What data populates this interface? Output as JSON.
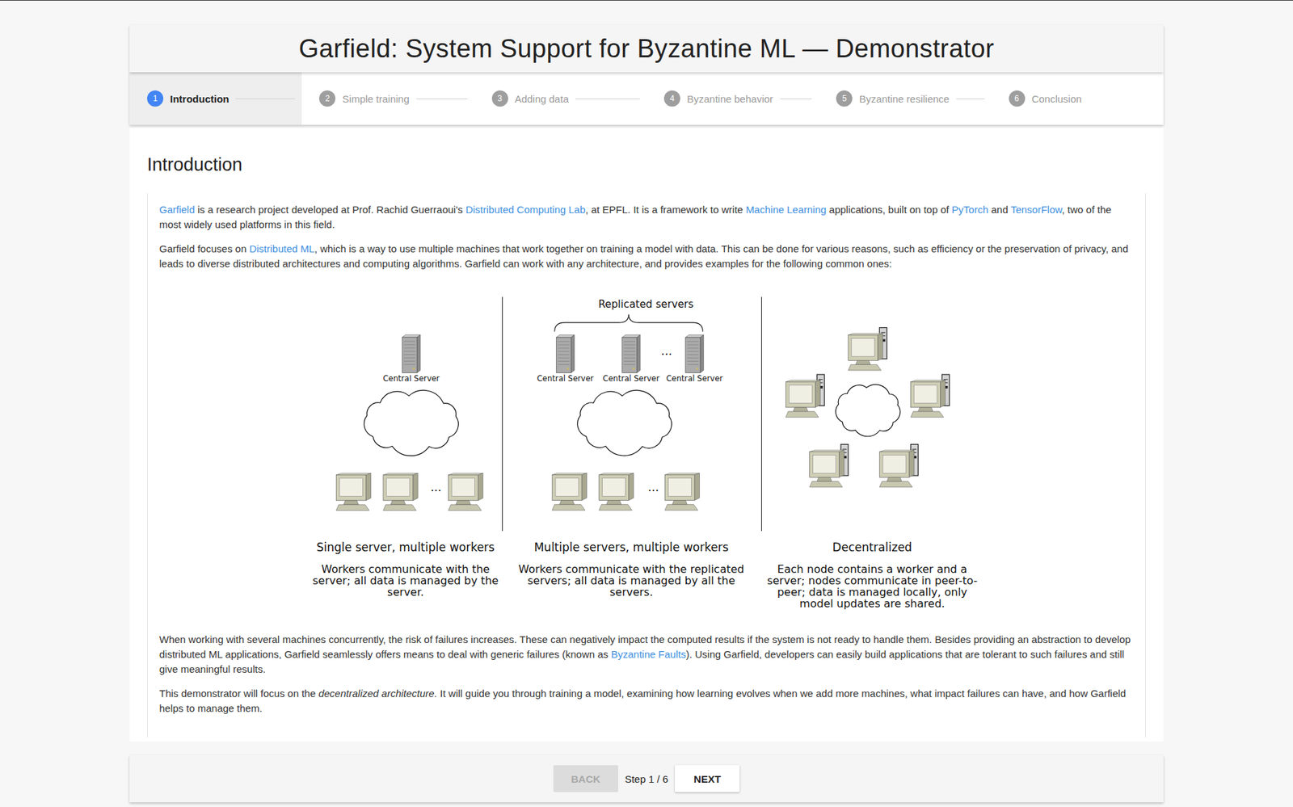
{
  "window": {
    "title": "Garfield: System Support for Byzantine ML — Demonstrator"
  },
  "steps": [
    {
      "number": "1",
      "label": "Introduction",
      "selected": true
    },
    {
      "number": "2",
      "label": "Simple training",
      "selected": false
    },
    {
      "number": "3",
      "label": "Adding data",
      "selected": false
    },
    {
      "number": "4",
      "label": "Byzantine behavior",
      "selected": false
    },
    {
      "number": "5",
      "label": "Byzantine resilience",
      "selected": false
    },
    {
      "number": "6",
      "label": "Conclusion",
      "selected": false
    }
  ],
  "section": {
    "heading": "Introduction"
  },
  "paragraphs_before": [
    [
      {
        "kind": "link",
        "text": "Garfield"
      },
      {
        "kind": "text",
        "text": " is a research project developed at Prof. Rachid Guerraoui's "
      },
      {
        "kind": "link",
        "text": "Distributed Computing Lab"
      },
      {
        "kind": "text",
        "text": ", at EPFL. It is a framework to write "
      },
      {
        "kind": "link",
        "text": "Machine Learning"
      },
      {
        "kind": "text",
        "text": " applications, built on top of "
      },
      {
        "kind": "link",
        "text": "PyTorch"
      },
      {
        "kind": "text",
        "text": " and "
      },
      {
        "kind": "link",
        "text": "TensorFlow"
      },
      {
        "kind": "text",
        "text": ", two of the most widely used platforms in this field."
      }
    ],
    [
      {
        "kind": "text",
        "text": "Garfield focuses on "
      },
      {
        "kind": "link",
        "text": "Distributed ML"
      },
      {
        "kind": "text",
        "text": ", which is a way to use multiple machines that work together on training a model with data. This can be done for various reasons, such as efficiency or the preservation of privacy, and leads to diverse distributed architectures and computing algorithms. Garfield can work with any architecture, and provides examples for the following common ones:"
      }
    ]
  ],
  "figure": {
    "panels": [
      {
        "kind": "single",
        "servers": [
          "Central Server"
        ],
        "workers_ellipsis": "...",
        "title": "Single server, multiple workers",
        "description": "Workers communicate with the server; all data is managed by the server."
      },
      {
        "kind": "replicated",
        "group_label": "Replicated servers",
        "servers": [
          "Central Server",
          "Central Server",
          "Central Server"
        ],
        "servers_ellipsis": "...",
        "workers_ellipsis": "...",
        "title": "Multiple servers, multiple workers",
        "description": "Workers communicate with the replicated servers; all data is managed by all the servers."
      },
      {
        "kind": "decentralized",
        "title": "Decentralized",
        "description": "Each node contains a worker and a server; nodes communicate in peer-to-peer; data is managed locally, only model updates are shared."
      }
    ]
  },
  "paragraphs_after": [
    [
      {
        "kind": "text",
        "text": "When working with several machines concurrently, the risk of failures increases. These can negatively impact the computed results if the system is not ready to handle them. Besides providing an abstraction to develop distributed ML applications, Garfield seamlessly offers means to deal with generic failures (known as "
      },
      {
        "kind": "link",
        "text": "Byzantine Faults"
      },
      {
        "kind": "text",
        "text": "). Using Garfield, developers can easily build applications that are tolerant to such failures and still give meaningful results."
      }
    ],
    [
      {
        "kind": "text",
        "text": "This demonstrator will focus on the "
      },
      {
        "kind": "em",
        "text": "decentralized architecture."
      },
      {
        "kind": "text",
        "text": " It will guide you through training a model, examining how learning evolves when we add more machines, what impact failures can have, and how Garfield helps to manage them."
      }
    ]
  ],
  "footer": {
    "back": {
      "label": "BACK",
      "disabled": true
    },
    "step_text": "Step 1 / 6",
    "next": {
      "label": "NEXT",
      "disabled": false
    }
  }
}
